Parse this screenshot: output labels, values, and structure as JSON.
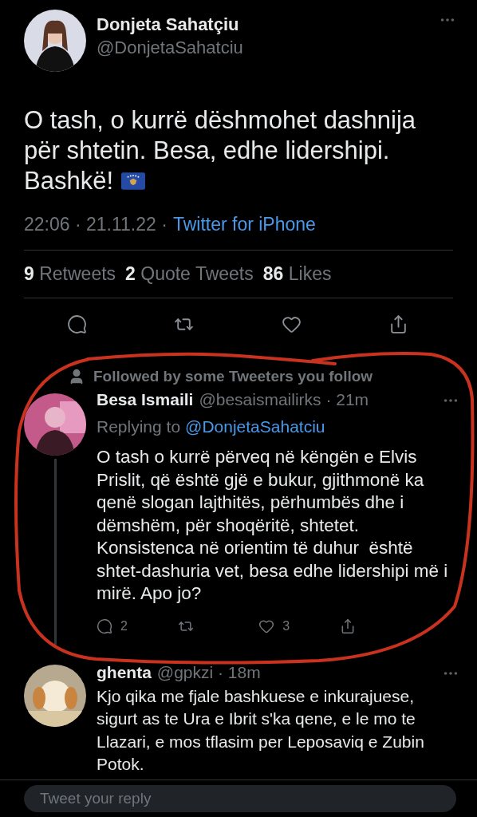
{
  "tweet": {
    "author": {
      "name": "Donjeta Sahatçiu",
      "handle": "@DonjetaSahatciu"
    },
    "text": "O tash, o kurrë dëshmohet dashnija për shtetin. Besa, edhe lidershipi.",
    "text_end": "Bashkë!",
    "meta": "22:06 · 21.11.22 ·",
    "source": "Twitter for iPhone",
    "stats": [
      {
        "text": "**9** Retweets"
      },
      {
        "text": "**2** Quote Tweets"
      },
      {
        "text": "**86** Likes"
      }
    ],
    "actions": [
      {
        "kind": "reply"
      },
      {
        "kind": "retweet"
      },
      {
        "kind": "like"
      },
      {
        "kind": "share"
      }
    ]
  },
  "replies": [
    {
      "context": "Followed by some Tweeters you follow",
      "name": "Besa Ismaili",
      "meta": "@besaismailirks · 21m",
      "replying_label": "Replying to",
      "replying_handle": "@DonjetaSahatciu",
      "text": "O tash o kurrë përveq në këngën e Elvis Prislit, që është gjë e bukur, gjithmonë ka qenë slogan lajthitës, përhumbës dhe i dëmshëm, për shoqëritë, shtetet. Konsistenca në orientim të duhur  është shtet-dashuria vet, besa edhe lidershipi më i mirë. Apo jo?",
      "thread_line": true,
      "actions": [
        {
          "kind": "reply",
          "count": "2"
        },
        {
          "kind": "retweet"
        },
        {
          "kind": "like",
          "count": "3"
        },
        {
          "kind": "share"
        }
      ]
    },
    {
      "name": "ghenta",
      "meta": "@gpkzi · 18m",
      "text": "Kjo qika me fjale bashkuese e inkurajuese, sigurt as te Ura e Ibrit s'ka qene, e le mo te Llazari, e mos tflasim per Leposaviq e Zubin Potok.",
      "thread_line": false
    }
  ],
  "reply_box": {
    "placeholder": "Tweet your reply"
  }
}
